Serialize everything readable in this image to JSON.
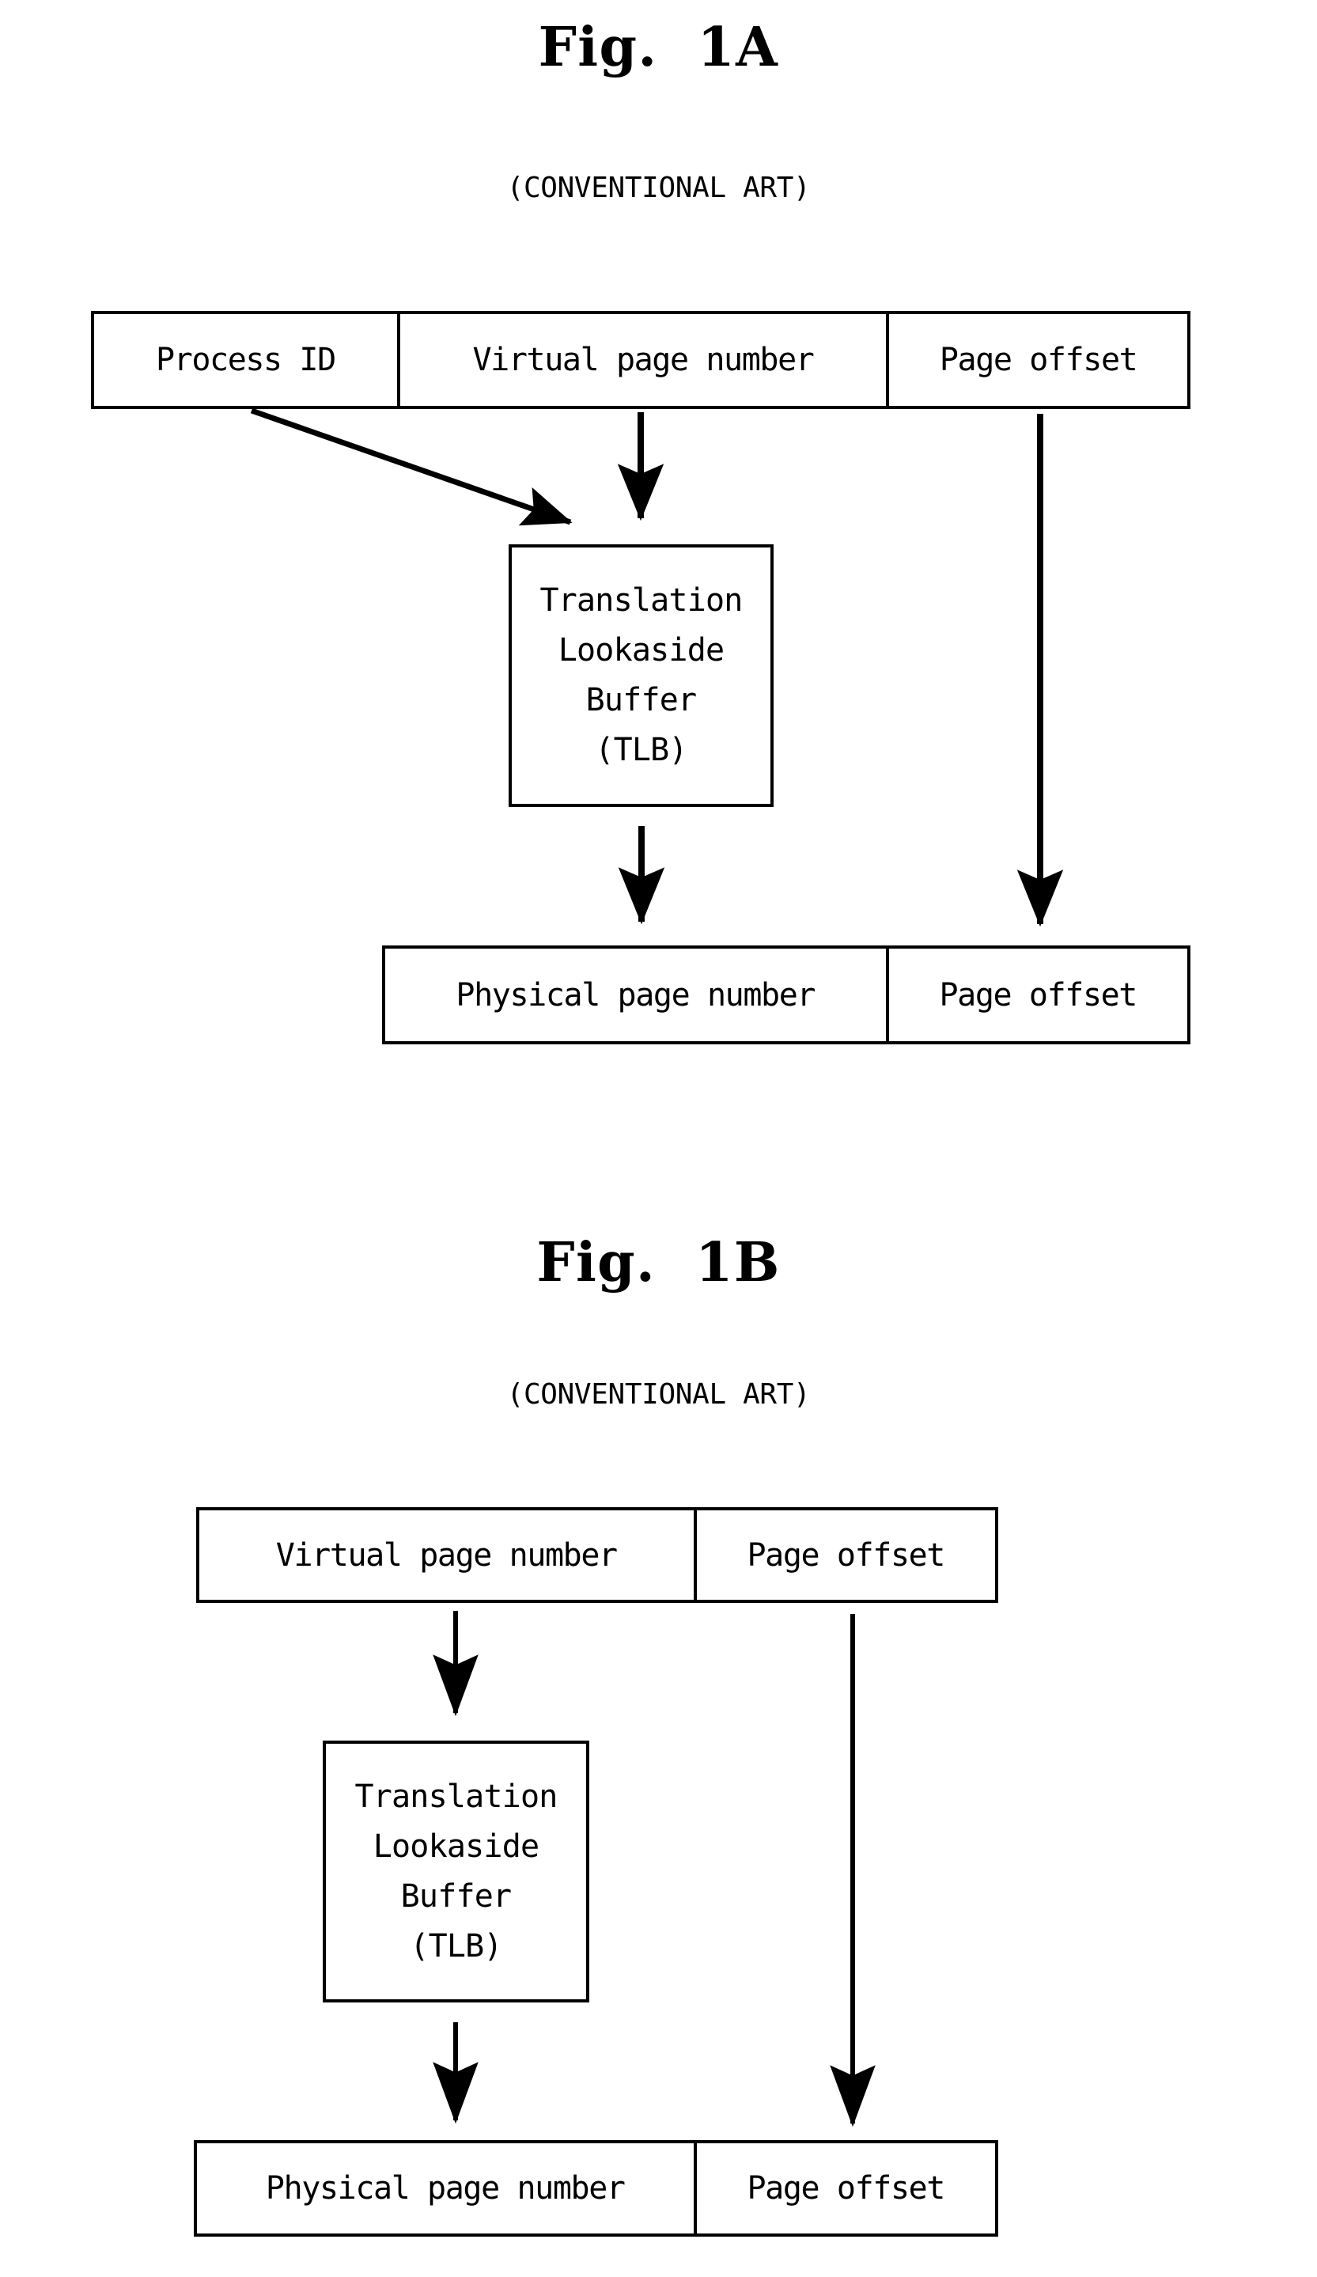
{
  "document": {
    "kind": "patent-drawing-sheet",
    "figures": [
      {
        "id": "fig-1a",
        "title": "Fig.  1A",
        "subtitle": "(CONVENTIONAL ART)",
        "virtual_address_row": {
          "name": "virtual-address-fields",
          "cells": [
            {
              "label": "Process ID"
            },
            {
              "label": "Virtual page number"
            },
            {
              "label": "Page offset"
            }
          ]
        },
        "tlb": {
          "name": "translation-lookaside-buffer",
          "lines": [
            "Translation",
            "Lookaside",
            "Buffer",
            "(TLB)"
          ]
        },
        "physical_address_row": {
          "name": "physical-address-fields",
          "cells": [
            {
              "label": "Physical page number"
            },
            {
              "label": "Page offset"
            }
          ]
        },
        "connectors": [
          {
            "name": "process-id-to-tlb-arrow",
            "style": "diagonal"
          },
          {
            "name": "virtual-page-number-to-tlb-arrow",
            "style": "vertical"
          },
          {
            "name": "tlb-to-physical-page-number-arrow",
            "style": "vertical"
          },
          {
            "name": "page-offset-passthrough-arrow",
            "style": "vertical"
          }
        ]
      },
      {
        "id": "fig-1b",
        "title": "Fig.  1B",
        "subtitle": "(CONVENTIONAL ART)",
        "virtual_address_row": {
          "name": "virtual-address-fields",
          "cells": [
            {
              "label": "Virtual page number"
            },
            {
              "label": "Page offset"
            }
          ]
        },
        "tlb": {
          "name": "translation-lookaside-buffer",
          "lines": [
            "Translation",
            "Lookaside",
            "Buffer",
            "(TLB)"
          ]
        },
        "physical_address_row": {
          "name": "physical-address-fields",
          "cells": [
            {
              "label": "Physical page number"
            },
            {
              "label": "Page offset"
            }
          ]
        },
        "connectors": [
          {
            "name": "virtual-page-number-to-tlb-arrow",
            "style": "vertical"
          },
          {
            "name": "tlb-to-physical-page-number-arrow",
            "style": "vertical"
          },
          {
            "name": "page-offset-passthrough-arrow",
            "style": "vertical"
          }
        ]
      }
    ],
    "colors": {
      "ink": "#000000",
      "paper": "#ffffff"
    }
  }
}
